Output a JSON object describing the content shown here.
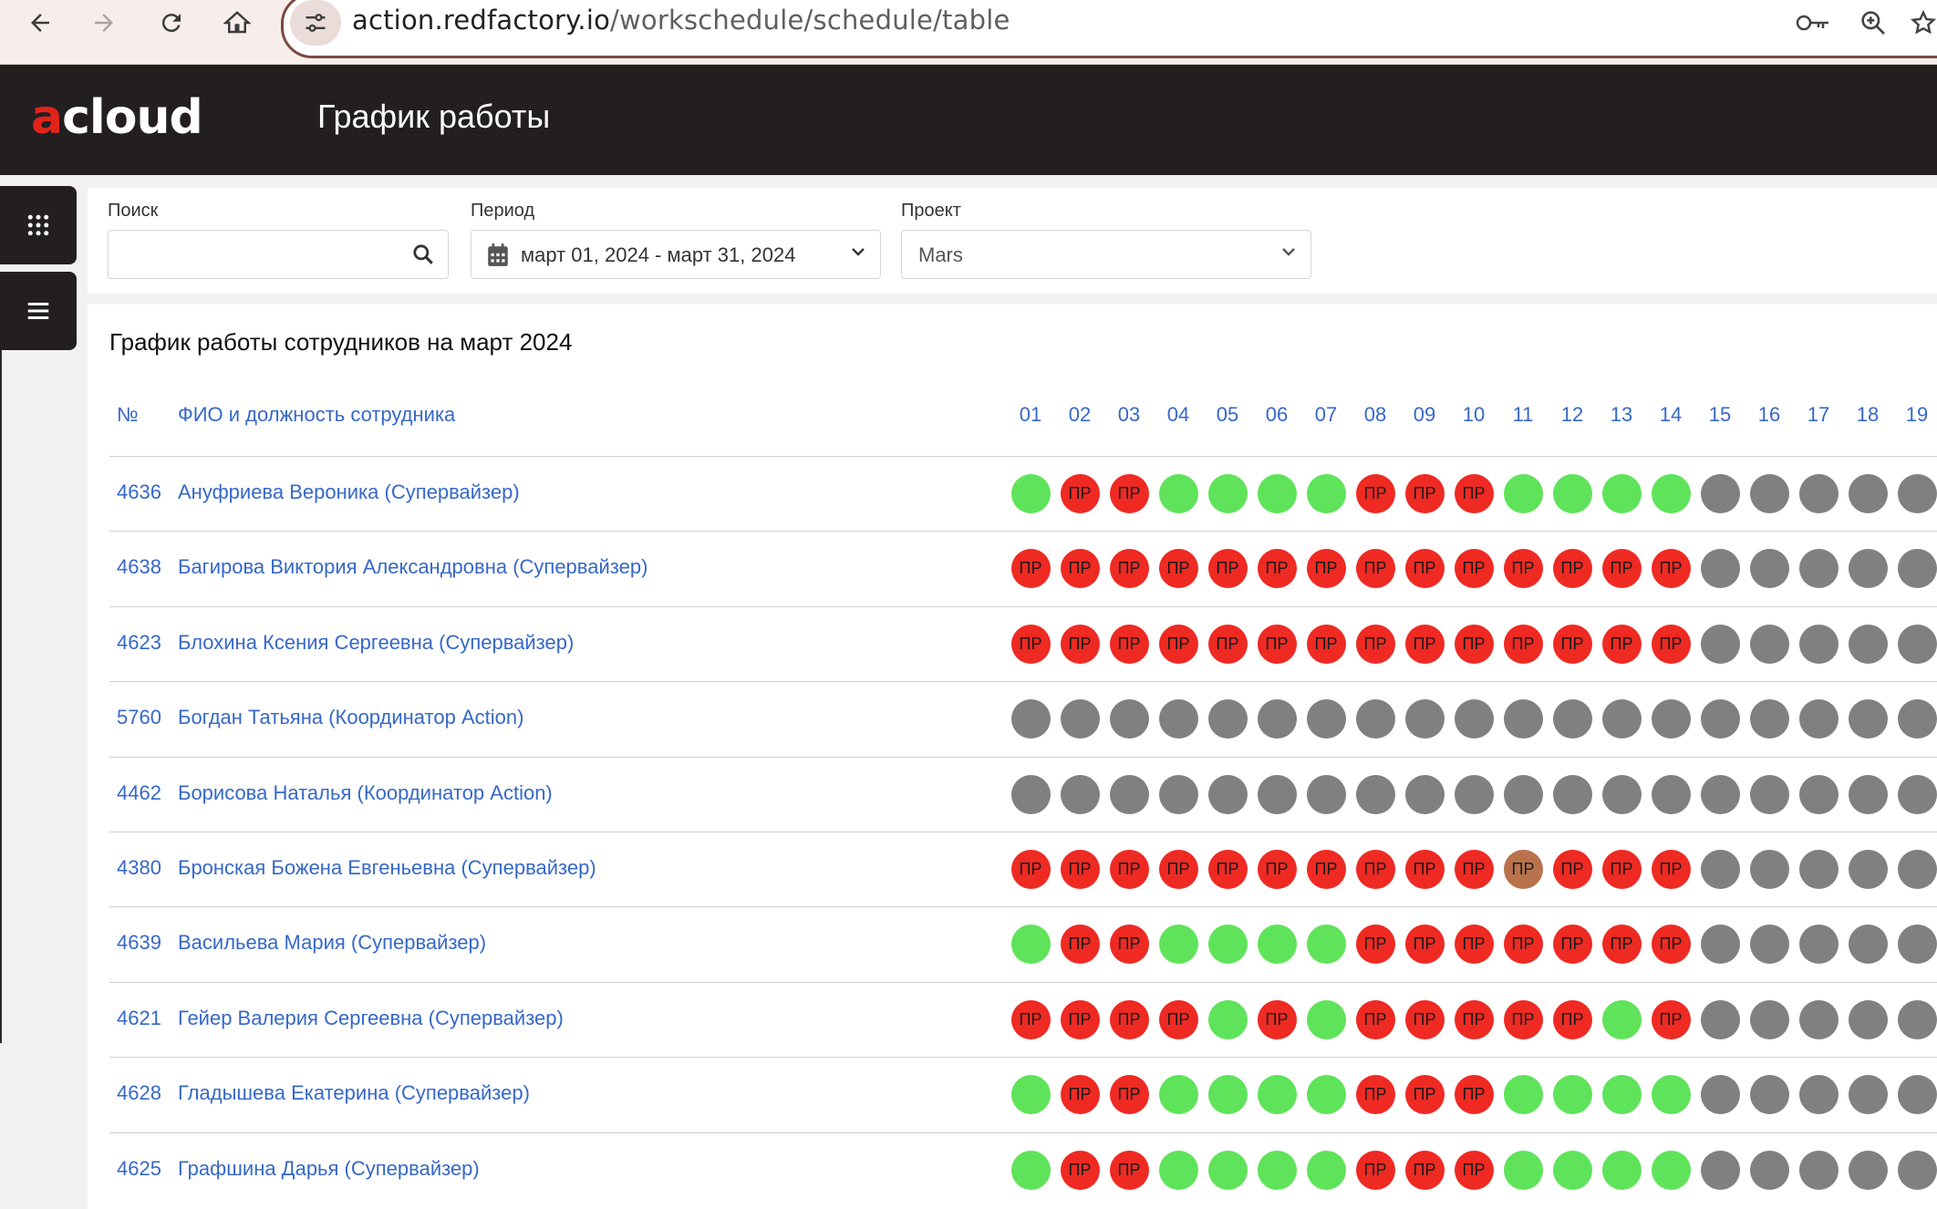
{
  "browser": {
    "url_host": "action.redfactory.io",
    "url_path": "/workschedule/schedule/table"
  },
  "app": {
    "logo_prefix": "a",
    "logo_rest": "cloud",
    "page_title": "График работы"
  },
  "filters": {
    "search_label": "Поиск",
    "search_value": "",
    "period_label": "Период",
    "period_value": "март 01, 2024 - март 31, 2024",
    "project_label": "Проект",
    "project_value": "Mars"
  },
  "table": {
    "title": "График работы сотрудников на март 2024",
    "col_num": "№",
    "col_name": "ФИО и должность сотрудника",
    "days": [
      "01",
      "02",
      "03",
      "04",
      "05",
      "06",
      "07",
      "08",
      "09",
      "10",
      "11",
      "12",
      "13",
      "14",
      "15",
      "16",
      "17",
      "18",
      "19"
    ],
    "status_colors": {
      "work": "#5fe35a",
      "pr": "#ee2a23",
      "none": "#808080",
      "other": "#b8734c"
    },
    "pr_label": "ПР",
    "rows": [
      {
        "id": "4636",
        "name": "Ануфриева Вероника (Супервайзер)",
        "days": [
          "G",
          "R",
          "R",
          "G",
          "G",
          "G",
          "G",
          "R",
          "R",
          "R",
          "G",
          "G",
          "G",
          "G",
          "N",
          "N",
          "N",
          "N",
          "N"
        ]
      },
      {
        "id": "4638",
        "name": "Багирова Виктория Александровна (Супервайзер)",
        "days": [
          "R",
          "R",
          "R",
          "R",
          "R",
          "R",
          "R",
          "R",
          "R",
          "R",
          "R",
          "R",
          "R",
          "R",
          "N",
          "N",
          "N",
          "N",
          "N"
        ]
      },
      {
        "id": "4623",
        "name": "Блохина Ксения Сергеевна (Супервайзер)",
        "days": [
          "R",
          "R",
          "R",
          "R",
          "R",
          "R",
          "R",
          "R",
          "R",
          "R",
          "R",
          "R",
          "R",
          "R",
          "N",
          "N",
          "N",
          "N",
          "N"
        ]
      },
      {
        "id": "5760",
        "name": "Богдан Татьяна (Координатор Action)",
        "days": [
          "N",
          "N",
          "N",
          "N",
          "N",
          "N",
          "N",
          "N",
          "N",
          "N",
          "N",
          "N",
          "N",
          "N",
          "N",
          "N",
          "N",
          "N",
          "N"
        ]
      },
      {
        "id": "4462",
        "name": "Борисова Наталья (Координатор Action)",
        "days": [
          "N",
          "N",
          "N",
          "N",
          "N",
          "N",
          "N",
          "N",
          "N",
          "N",
          "N",
          "N",
          "N",
          "N",
          "N",
          "N",
          "N",
          "N",
          "N"
        ]
      },
      {
        "id": "4380",
        "name": "Бронская Божена Евгеньевна (Супервайзер)",
        "days": [
          "R",
          "R",
          "R",
          "R",
          "R",
          "R",
          "R",
          "R",
          "R",
          "R",
          "B",
          "R",
          "R",
          "R",
          "N",
          "N",
          "N",
          "N",
          "N"
        ]
      },
      {
        "id": "4639",
        "name": "Васильева Мария (Супервайзер)",
        "days": [
          "G",
          "R",
          "R",
          "G",
          "G",
          "G",
          "G",
          "R",
          "R",
          "R",
          "R",
          "R",
          "R",
          "R",
          "N",
          "N",
          "N",
          "N",
          "N"
        ]
      },
      {
        "id": "4621",
        "name": "Гейер Валерия Сергеевна (Супервайзер)",
        "days": [
          "R",
          "R",
          "R",
          "R",
          "G",
          "R",
          "G",
          "R",
          "R",
          "R",
          "R",
          "R",
          "G",
          "R",
          "N",
          "N",
          "N",
          "N",
          "N"
        ]
      },
      {
        "id": "4628",
        "name": "Гладышева Екатерина (Супервайзер)",
        "days": [
          "G",
          "R",
          "R",
          "G",
          "G",
          "G",
          "G",
          "R",
          "R",
          "R",
          "G",
          "G",
          "G",
          "G",
          "N",
          "N",
          "N",
          "N",
          "N"
        ]
      },
      {
        "id": "4625",
        "name": "Графшина Дарья (Супервайзер)",
        "days": [
          "G",
          "R",
          "R",
          "G",
          "G",
          "G",
          "G",
          "R",
          "R",
          "R",
          "G",
          "G",
          "G",
          "G",
          "N",
          "N",
          "N",
          "N",
          "N"
        ]
      }
    ]
  }
}
